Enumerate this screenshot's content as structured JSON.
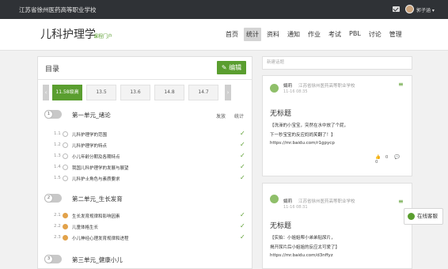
{
  "topbar": {
    "school": "江苏省徐州医药高等职业学校",
    "user": "郭子涵 ▾"
  },
  "header": {
    "course": "儿科护理学",
    "portal": "课程门户"
  },
  "nav": [
    "首页",
    "统计",
    "资料",
    "通知",
    "作业",
    "考试",
    "PBL",
    "讨论",
    "管理"
  ],
  "catalog": {
    "title": "目录",
    "edit_label": "编辑",
    "tabs": [
      "11.58级高",
      "13.5",
      "13.6",
      "14.8",
      "14.7"
    ],
    "col_publish": "发放",
    "col_stats": "统计",
    "units": [
      {
        "index": "1",
        "name": "第一单元_绪论",
        "items": [
          {
            "num": "1.1",
            "label": "儿科护理学的范围"
          },
          {
            "num": "1.2",
            "label": "儿科护理学的特点"
          },
          {
            "num": "1.3",
            "label": "小儿年龄分期及各期特点"
          },
          {
            "num": "1.4",
            "label": "我国儿科护理学的发展与展望"
          },
          {
            "num": "1.5",
            "label": "儿科护士角色与素质要求"
          }
        ]
      },
      {
        "index": "2",
        "name": "第二单元_生长发育",
        "items": [
          {
            "num": "2.1",
            "label": "生长发育规律和影响因素"
          },
          {
            "num": "2.2",
            "label": "儿童体格生长"
          },
          {
            "num": "2.3",
            "label": "小儿神经心理发育规律和进程"
          }
        ]
      },
      {
        "index": "3",
        "name": "第三单元_健康小儿",
        "items": []
      }
    ]
  },
  "discussion": {
    "new_topic_placeholder": "新建话题",
    "posts": [
      {
        "author": "娟莉",
        "org": "江苏省徐州医药高等职业学校",
        "date": "11-16 08:35",
        "title": "无标题",
        "lines": [
          "【洗澡的小宝宝，突然在水中放了个屁，",
          "下一秒宝宝的反应妈妈笑翻了！】",
          "https://mr.baidu.com/r1gpycp"
        ],
        "likes": "0",
        "comments": "0"
      },
      {
        "author": "娟莉",
        "org": "江苏省徐州医药高等职业学校",
        "date": "11-16 08:31",
        "title": "无标题",
        "lines": [
          "【实拍：小姐姐帮小弟弟贴尿片，",
          "揭开尿片后小姐姐的反应太可爱了】",
          "https://mr.baidu.com/d3nffyz"
        ]
      }
    ]
  },
  "online_service": "在线客服",
  "colors": {
    "accent": "#5a9e2f",
    "topbar": "#2f3236"
  }
}
